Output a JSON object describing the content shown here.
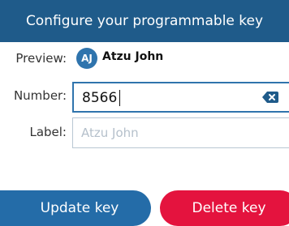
{
  "header": {
    "title": "Configure your programmable key"
  },
  "preview": {
    "label": "Preview:",
    "avatar_initials": "AJ",
    "name": "Atzu John"
  },
  "number": {
    "label": "Number:",
    "value": "8566"
  },
  "label_field": {
    "label": "Label:",
    "placeholder": "Atzu John"
  },
  "buttons": {
    "update": "Update key",
    "delete": "Delete key"
  },
  "colors": {
    "header": "#1f5b8a",
    "primary": "#246ca8",
    "danger": "#e4133e",
    "border": "#b9c7d3"
  }
}
